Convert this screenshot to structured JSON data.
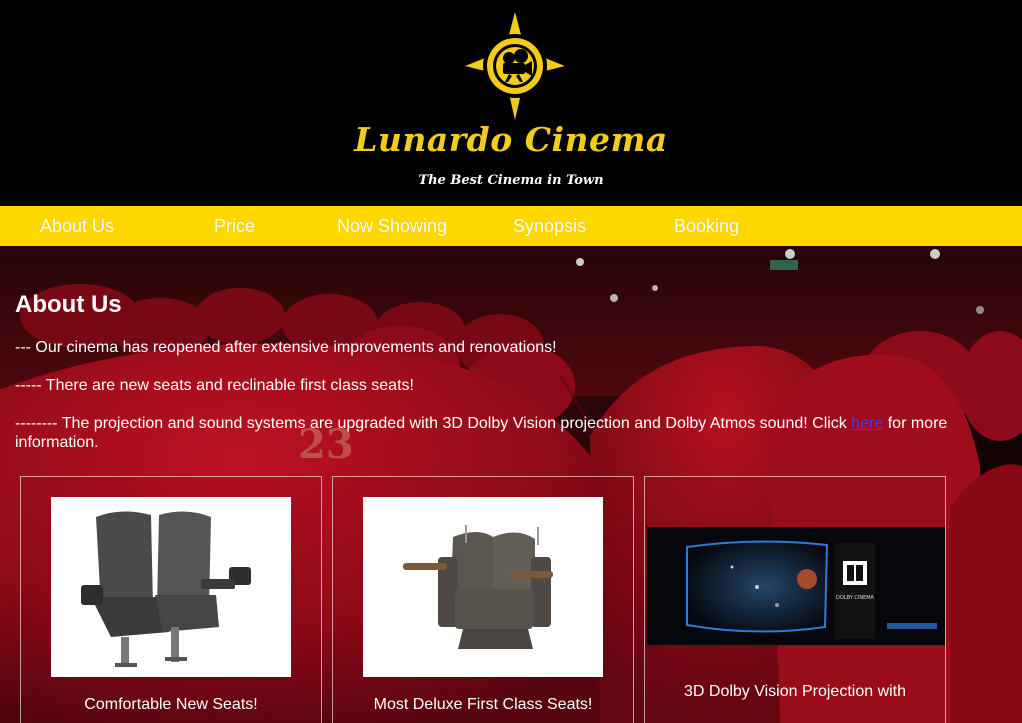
{
  "brand": {
    "name": "Lunardo Cinema",
    "tagline": "The Best Cinema in Town"
  },
  "nav": {
    "items": [
      {
        "label": "About Us"
      },
      {
        "label": "Price"
      },
      {
        "label": "Now Showing"
      },
      {
        "label": "Synopsis"
      },
      {
        "label": "Booking"
      }
    ]
  },
  "about": {
    "title": "About Us",
    "p1": "--- Our cinema has reopened after extensive improvements and renovations!",
    "p2": "----- There are new seats and reclinable first class seats!",
    "p3_before": "-------- The projection and sound systems are upgraded with 3D Dolby Vision projection and Dolby Atmos sound! Click ",
    "p3_link": "here",
    "p3_after": " for more information."
  },
  "cards": [
    {
      "caption": "Comfortable New Seats!"
    },
    {
      "caption": "Most Deluxe First Class Seats!"
    },
    {
      "caption": "3D Dolby Vision Projection with"
    }
  ],
  "seat_number": "23",
  "dolby_label": "DOLBY CINEMA",
  "colors": {
    "header_bg": "#000000",
    "nav_bg": "#ffd800",
    "brand_gold": "#f3cc1b",
    "link": "#3a3aff"
  }
}
